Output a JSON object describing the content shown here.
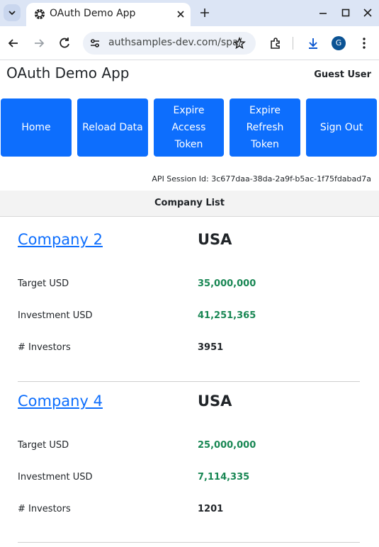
{
  "browser": {
    "tab_title": "OAuth Demo App",
    "url": "authsamples-dev.com/spa/",
    "profile_initial": "G",
    "accent": "#0b5394"
  },
  "app": {
    "title": "OAuth Demo App",
    "user": "Guest User",
    "buttons": {
      "home": "Home",
      "reload": "Reload Data",
      "expire_access": "Expire Access Token",
      "expire_refresh": "Expire Refresh Token",
      "sign_out": "Sign Out"
    },
    "button_color": "#0d6efd",
    "session_id": "API Session Id: 3c677daa-38da-2a9f-b5ac-1f75fdabad7a",
    "list_header": "Company List",
    "row_labels": {
      "target": "Target USD",
      "investment": "Investment USD",
      "investors": "# Investors"
    },
    "companies": [
      {
        "name": "Company 2",
        "region": "USA",
        "target_usd": "35,000,000",
        "investment_usd": "41,251,365",
        "investors": "3951"
      },
      {
        "name": "Company 4",
        "region": "USA",
        "target_usd": "25,000,000",
        "investment_usd": "7,114,335",
        "investors": "1201"
      }
    ]
  }
}
